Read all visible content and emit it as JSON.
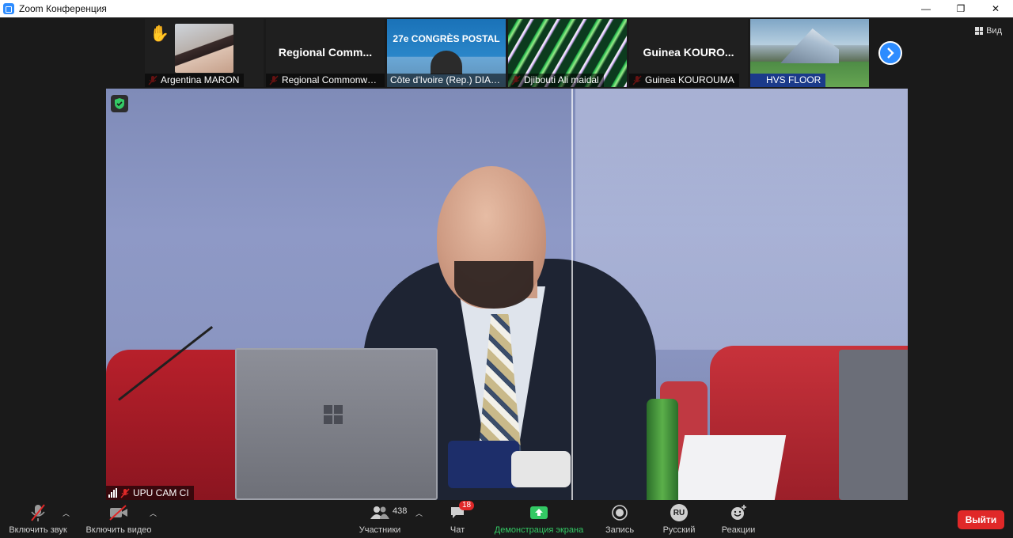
{
  "window": {
    "title": "Zoom Конференция",
    "minimize": "—",
    "restore": "❐",
    "close": "✕"
  },
  "view_button": {
    "label": "Вид"
  },
  "participants_strip": [
    {
      "name": "Argentina MARON",
      "big_label": "",
      "hand_raised": true,
      "muted": true
    },
    {
      "name": "Regional Commonwe...",
      "big_label": "Regional Comm...",
      "muted": true
    },
    {
      "name": "Côte d'Ivoire (Rep.) DIAK...",
      "big_label": "",
      "backdrop_text": "27e CONGRÈS POSTAL",
      "muted": false
    },
    {
      "name": "Djibouti Ali maidal",
      "big_label": "",
      "muted": true
    },
    {
      "name": "Guinea KOUROUMA",
      "big_label": "Guinea KOURO...",
      "muted": true
    },
    {
      "name": "HVS FLOOR",
      "big_label": "",
      "muted": true
    }
  ],
  "active_speaker": {
    "name": "UPU CAM CI",
    "muted": true
  },
  "toolbar": {
    "audio": {
      "label": "Включить звук",
      "icon": "mic-muted-icon"
    },
    "video": {
      "label": "Включить видео",
      "icon": "video-off-icon"
    },
    "participants": {
      "label": "Участники",
      "count": "438",
      "icon": "participants-icon"
    },
    "chat": {
      "label": "Чат",
      "badge": "18",
      "icon": "chat-icon"
    },
    "share": {
      "label": "Демонстрация экрана",
      "icon": "share-screen-icon"
    },
    "record": {
      "label": "Запись",
      "icon": "record-icon"
    },
    "language": {
      "label": "Русский",
      "code": "RU",
      "icon": "language-icon"
    },
    "reactions": {
      "label": "Реакции",
      "icon": "reactions-icon"
    },
    "leave": {
      "label": "Выйти"
    }
  },
  "colors": {
    "accent": "#2d8cff",
    "leave": "#e02828",
    "share_green": "#33c964",
    "muted_red": "#e02828"
  }
}
